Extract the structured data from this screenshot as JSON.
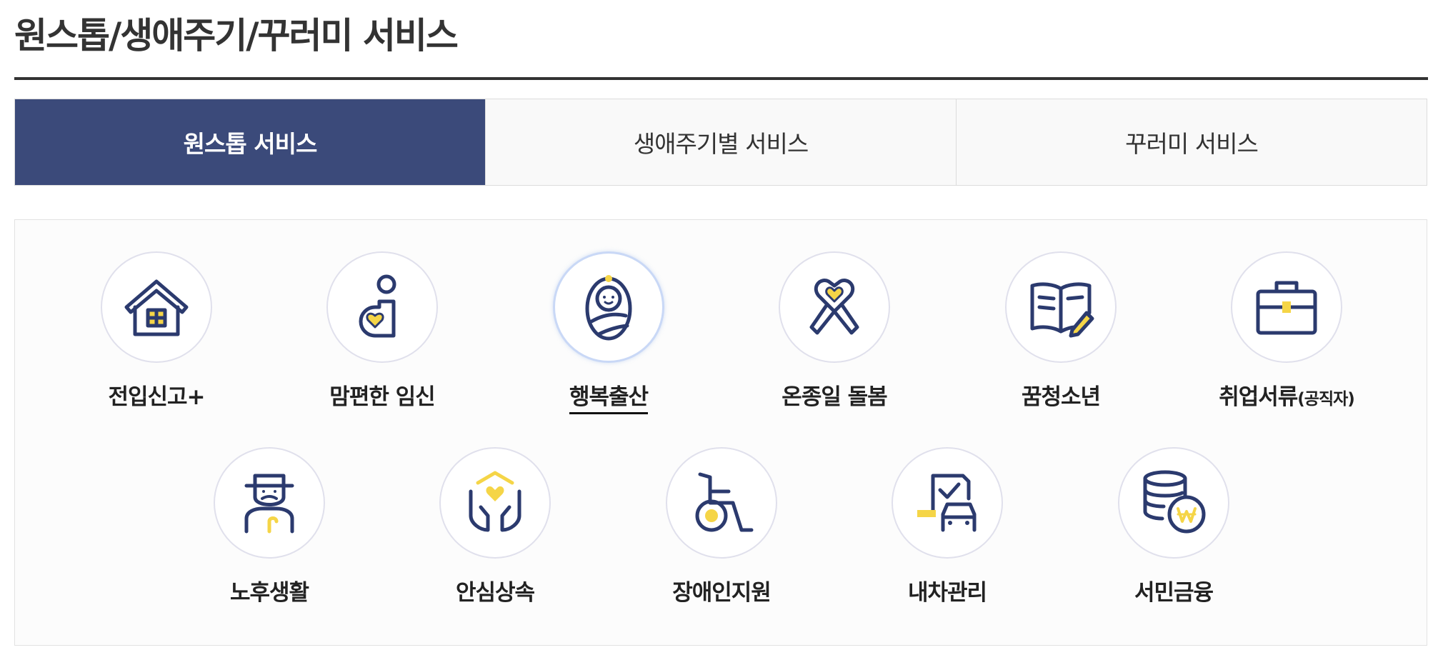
{
  "page": {
    "title": "원스톱/생애주기/꾸러미 서비스"
  },
  "tabs": [
    {
      "label": "원스톱 서비스",
      "active": true
    },
    {
      "label": "생애주기별 서비스",
      "active": false
    },
    {
      "label": "꾸러미 서비스",
      "active": false
    }
  ],
  "services": {
    "row1": [
      {
        "label": "전입신고+",
        "icon": "house-icon"
      },
      {
        "label": "맘편한 임신",
        "icon": "pregnant-woman-icon"
      },
      {
        "label": "행복출산",
        "icon": "swaddled-baby-icon",
        "active": true
      },
      {
        "label": "온종일 돌봄",
        "icon": "heart-ribbon-icon"
      },
      {
        "label": "꿈청소년",
        "icon": "open-book-pencil-icon"
      },
      {
        "label": "취업서류",
        "label_suffix": "(공직자)",
        "icon": "briefcase-icon"
      }
    ],
    "row2": [
      {
        "label": "노후생활",
        "icon": "elderly-man-icon"
      },
      {
        "label": "안심상속",
        "icon": "hands-heart-icon"
      },
      {
        "label": "장애인지원",
        "icon": "wheelchair-icon"
      },
      {
        "label": "내차관리",
        "icon": "car-document-icon"
      },
      {
        "label": "서민금융",
        "icon": "coins-won-icon"
      }
    ]
  },
  "colors": {
    "navy": "#2b3a6e",
    "yellow": "#f5d547",
    "tab_active": "#3b4a7a"
  }
}
